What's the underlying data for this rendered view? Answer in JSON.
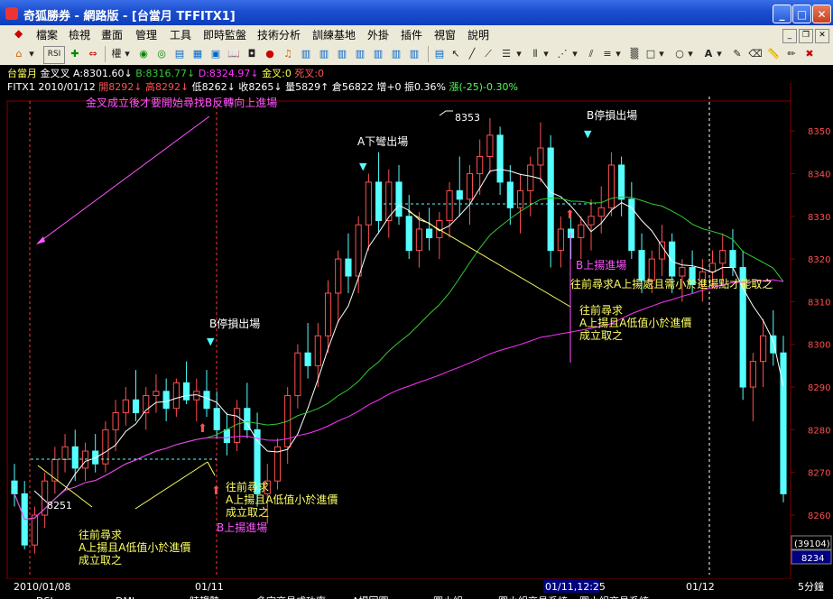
{
  "window": {
    "title": "奇狐勝券 - 網路版 - [台當月 TFFITX1]"
  },
  "menu": [
    "檔案",
    "檢視",
    "畫面",
    "管理",
    "工具",
    "即時監盤",
    "技術分析",
    "訓練基地",
    "外掛",
    "插件",
    "視窗",
    "說明"
  ],
  "toolbar": {
    "rsi_label": "RSI",
    "quan_label": "權"
  },
  "header": {
    "line1": {
      "name": "台當月",
      "indicator": "金叉叉",
      "a": "A:8301.60",
      "b": "B:8316.77",
      "d": "D:8324.97",
      "gx": "金叉:0",
      "dx": "死叉:0"
    },
    "line2": {
      "symbol": "FITX1",
      "date": "2010/01/12",
      "open": "開8292",
      "high": "高8292",
      "low": "低8262",
      "close": "收8265",
      "vol": "量5829",
      "oi": "倉56822",
      "inc": "增+0",
      "amp": "振0.36%",
      "chg": "漲(-25)-0.30%"
    }
  },
  "annotations": {
    "top_note": "金叉成立後才要開始尋找B反轉向上進場",
    "low_label": "8251",
    "high_label": "8353",
    "a_exit": "A下彎出場",
    "b_stop1": "B停損出場",
    "b_stop2": "B停損出場",
    "b_entry1": "B上揚進場",
    "b_entry2": "B上揚進場",
    "rule1_l1": "往前尋求",
    "rule1_l2": "A上揚且A低值小於進價",
    "rule1_l3": "成立取之",
    "rule2_l1": "往前尋求",
    "rule2_l2": "A上揚且A低值小於進價",
    "rule2_l3": "成立取之",
    "rule3_l1": "往前尋求",
    "rule3_l2": "A上揚且A低值小於進價",
    "rule3_l3": "成立取之",
    "rule4": "往前尋求A上揚處且需小於進場點才能取之"
  },
  "xaxis": {
    "labels": [
      "2010/01/08",
      "01/11",
      "01/11,12:25",
      "01/12"
    ],
    "period": "5分鐘"
  },
  "yaxis": {
    "ticks": [
      8260,
      8270,
      8280,
      8290,
      8300,
      8310,
      8320,
      8330,
      8340,
      8350
    ],
    "vol_box": "(39104)",
    "last_price": "8234"
  },
  "bottom_tabs": [
    "DSL",
    "DMI",
    "時趨勢",
    "多空交易成功率",
    "A場回圖",
    "圖小組",
    "圖小組交易系統",
    "圖小組交易系統"
  ],
  "colors": {
    "up": "#ff5050",
    "down": "#55ffff",
    "ma_a": "#ffffff",
    "ma_b": "#33cc33",
    "ma_d": "#ff33ff",
    "note_yellow": "#ffff66",
    "note_magenta": "#ff55ff"
  },
  "chart_data": {
    "type": "candlestick",
    "ylim": [
      8245,
      8357
    ],
    "candles": [
      [
        8268,
        8272,
        8262,
        8265
      ],
      [
        8265,
        8268,
        8252,
        8253
      ],
      [
        8253,
        8262,
        8251,
        8260
      ],
      [
        8260,
        8270,
        8257,
        8268
      ],
      [
        8268,
        8276,
        8265,
        8273
      ],
      [
        8273,
        8279,
        8270,
        8276
      ],
      [
        8276,
        8280,
        8268,
        8271
      ],
      [
        8271,
        8277,
        8268,
        8275
      ],
      [
        8275,
        8279,
        8270,
        8272
      ],
      [
        8272,
        8282,
        8270,
        8280
      ],
      [
        8280,
        8287,
        8275,
        8284
      ],
      [
        8284,
        8290,
        8281,
        8287
      ],
      [
        8287,
        8294,
        8282,
        8284
      ],
      [
        8284,
        8290,
        8280,
        8288
      ],
      [
        8288,
        8293,
        8284,
        8289
      ],
      [
        8289,
        8292,
        8282,
        8285
      ],
      [
        8285,
        8292,
        8283,
        8291
      ],
      [
        8291,
        8296,
        8286,
        8287
      ],
      [
        8287,
        8292,
        8282,
        8289
      ],
      [
        8289,
        8294,
        8283,
        8285
      ],
      [
        8285,
        8289,
        8278,
        8280
      ],
      [
        8280,
        8284,
        8274,
        8277
      ],
      [
        8277,
        8287,
        8275,
        8285
      ],
      [
        8285,
        8291,
        8278,
        8280
      ],
      [
        8280,
        8284,
        8262,
        8265
      ],
      [
        8265,
        8272,
        8258,
        8268
      ],
      [
        8268,
        8278,
        8266,
        8276
      ],
      [
        8276,
        8290,
        8272,
        8288
      ],
      [
        8288,
        8300,
        8285,
        8298
      ],
      [
        8298,
        8305,
        8292,
        8295
      ],
      [
        8295,
        8305,
        8290,
        8302
      ],
      [
        8302,
        8315,
        8298,
        8312
      ],
      [
        8312,
        8322,
        8305,
        8320
      ],
      [
        8320,
        8326,
        8312,
        8316
      ],
      [
        8316,
        8330,
        8312,
        8328
      ],
      [
        8328,
        8340,
        8322,
        8338
      ],
      [
        8338,
        8345,
        8326,
        8329
      ],
      [
        8329,
        8341,
        8325,
        8338
      ],
      [
        8338,
        8342,
        8328,
        8330
      ],
      [
        8330,
        8335,
        8320,
        8322
      ],
      [
        8322,
        8331,
        8318,
        8327
      ],
      [
        8327,
        8332,
        8322,
        8325
      ],
      [
        8325,
        8331,
        8320,
        8329
      ],
      [
        8329,
        8338,
        8325,
        8336
      ],
      [
        8336,
        8344,
        8330,
        8334
      ],
      [
        8334,
        8342,
        8328,
        8340
      ],
      [
        8340,
        8348,
        8335,
        8344
      ],
      [
        8344,
        8353,
        8340,
        8349
      ],
      [
        8349,
        8351,
        8335,
        8338
      ],
      [
        8338,
        8342,
        8328,
        8332
      ],
      [
        8332,
        8340,
        8326,
        8336
      ],
      [
        8336,
        8344,
        8330,
        8342
      ],
      [
        8342,
        8352,
        8338,
        8346
      ],
      [
        8346,
        8349,
        8318,
        8322
      ],
      [
        8322,
        8330,
        8318,
        8327
      ],
      [
        8327,
        8331,
        8320,
        8325
      ],
      [
        8325,
        8330,
        8320,
        8328
      ],
      [
        8328,
        8334,
        8322,
        8330
      ],
      [
        8330,
        8337,
        8326,
        8332
      ],
      [
        8332,
        8345,
        8330,
        8342
      ],
      [
        8342,
        8344,
        8330,
        8334
      ],
      [
        8334,
        8338,
        8320,
        8322
      ],
      [
        8322,
        8326,
        8312,
        8315
      ],
      [
        8315,
        8322,
        8312,
        8320
      ],
      [
        8320,
        8328,
        8316,
        8324
      ],
      [
        8324,
        8326,
        8312,
        8316
      ],
      [
        8316,
        8320,
        8310,
        8318
      ],
      [
        8318,
        8322,
        8312,
        8314
      ],
      [
        8314,
        8320,
        8310,
        8317
      ],
      [
        8317,
        8322,
        8313,
        8319
      ],
      [
        8319,
        8326,
        8315,
        8322
      ],
      [
        8322,
        8327,
        8316,
        8318
      ],
      [
        8318,
        8322,
        8287,
        8290
      ],
      [
        8290,
        8298,
        8282,
        8296
      ],
      [
        8296,
        8306,
        8290,
        8302
      ],
      [
        8302,
        8308,
        8295,
        8298
      ],
      [
        8298,
        8302,
        8263,
        8265
      ]
    ],
    "series": [
      {
        "name": "A"
      },
      {
        "name": "B"
      },
      {
        "name": "D"
      }
    ]
  }
}
